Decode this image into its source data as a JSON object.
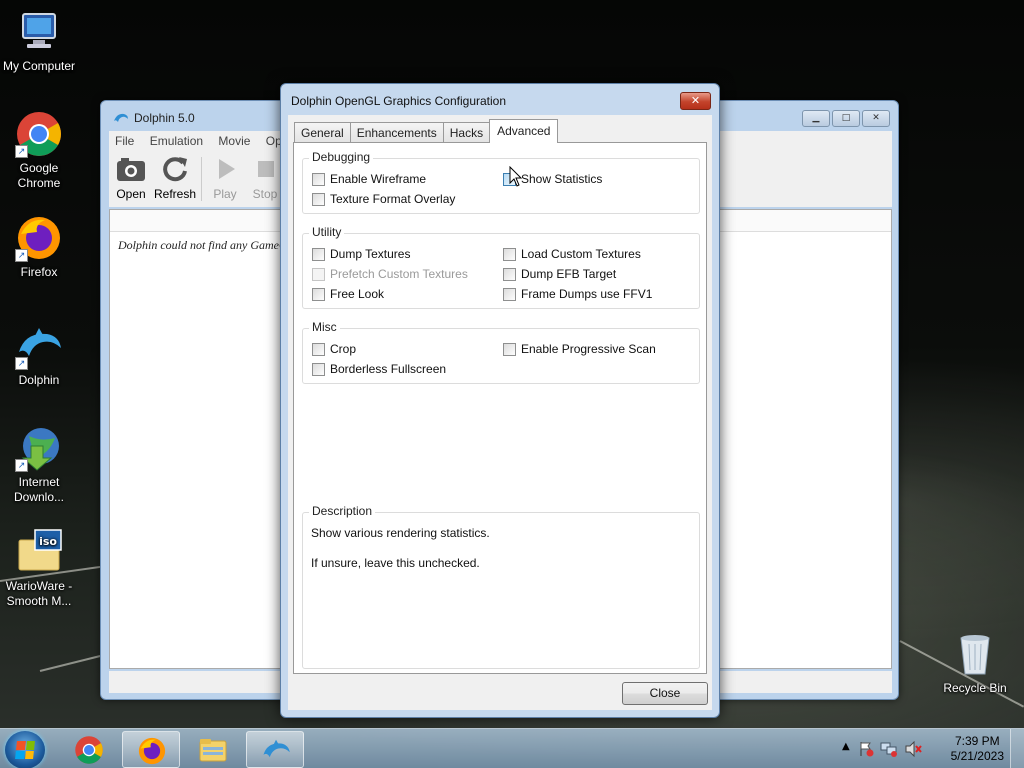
{
  "desktop": {
    "icons": [
      {
        "label": "My Computer",
        "icon": "computer-icon"
      },
      {
        "label": "Google Chrome",
        "icon": "chrome-icon"
      },
      {
        "label": "Firefox",
        "icon": "firefox-icon"
      },
      {
        "label": "Dolphin",
        "icon": "dolphin-icon"
      },
      {
        "label": "Internet Downlo...",
        "icon": "idm-icon"
      },
      {
        "label": "WarioWare - Smooth M...",
        "icon": "iso-file-icon"
      },
      {
        "label": "Recycle Bin",
        "icon": "recycle-bin-icon"
      }
    ]
  },
  "main_window": {
    "title": "Dolphin 5.0",
    "menu": [
      "File",
      "Emulation",
      "Movie",
      "Op"
    ],
    "toolbar": [
      {
        "label": "Open",
        "icon": "open-icon"
      },
      {
        "label": "Refresh",
        "icon": "refresh-icon"
      },
      {
        "label": "Play",
        "icon": "play-icon"
      },
      {
        "label": "Stop",
        "icon": "stop-icon"
      }
    ],
    "empty_message": "Dolphin could not find any GameC"
  },
  "dialog": {
    "title": "Dolphin OpenGL Graphics Configuration",
    "close_glyph": "✕",
    "tabs": [
      "General",
      "Enhancements",
      "Hacks",
      "Advanced"
    ],
    "active_tab": "Advanced",
    "groups": {
      "debugging": {
        "label": "Debugging",
        "options": [
          "Enable Wireframe",
          "Show Statistics",
          "Texture Format Overlay"
        ]
      },
      "utility": {
        "label": "Utility",
        "options": [
          "Dump Textures",
          "Load Custom Textures",
          "Prefetch Custom Textures",
          "Dump EFB Target",
          "Free Look",
          "Frame Dumps use FFV1"
        ]
      },
      "misc": {
        "label": "Misc",
        "options": [
          "Crop",
          "Enable Progressive Scan",
          "Borderless Fullscreen"
        ]
      },
      "description": {
        "label": "Description",
        "line1": "Show various rendering statistics.",
        "line2": "If unsure, leave this unchecked."
      }
    },
    "close_button": "Close"
  },
  "taskbar": {
    "apps": [
      "chrome-icon",
      "firefox-icon",
      "file-explorer-icon",
      "dolphin-icon"
    ],
    "clock_time": "7:39 PM",
    "clock_date": "5/21/2023"
  },
  "colors": {
    "accent": "#1c5fb8",
    "window_frame": "#c6d9ee",
    "close_button": "#c3432b"
  }
}
